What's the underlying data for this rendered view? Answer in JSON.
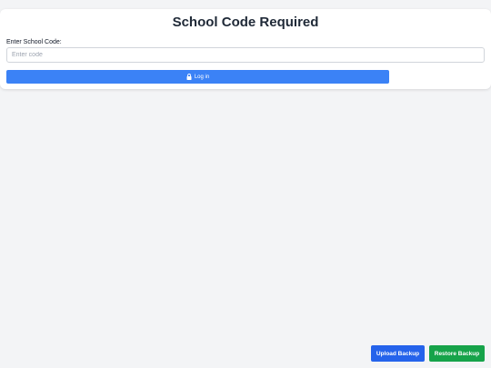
{
  "login_card": {
    "title": "School Code Required",
    "field_label": "Enter School Code:",
    "input_value": "",
    "input_placeholder": "Enter code",
    "login_button_label": "Log in",
    "login_button_icon": "lock-icon"
  },
  "footer_actions": {
    "upload_label": "Upload Backup",
    "restore_label": "Restore Backup"
  },
  "colors": {
    "page_background": "#f3f4f6",
    "login_button": "#3b82f6",
    "upload_button": "#2563eb",
    "restore_button": "#16a34a"
  }
}
